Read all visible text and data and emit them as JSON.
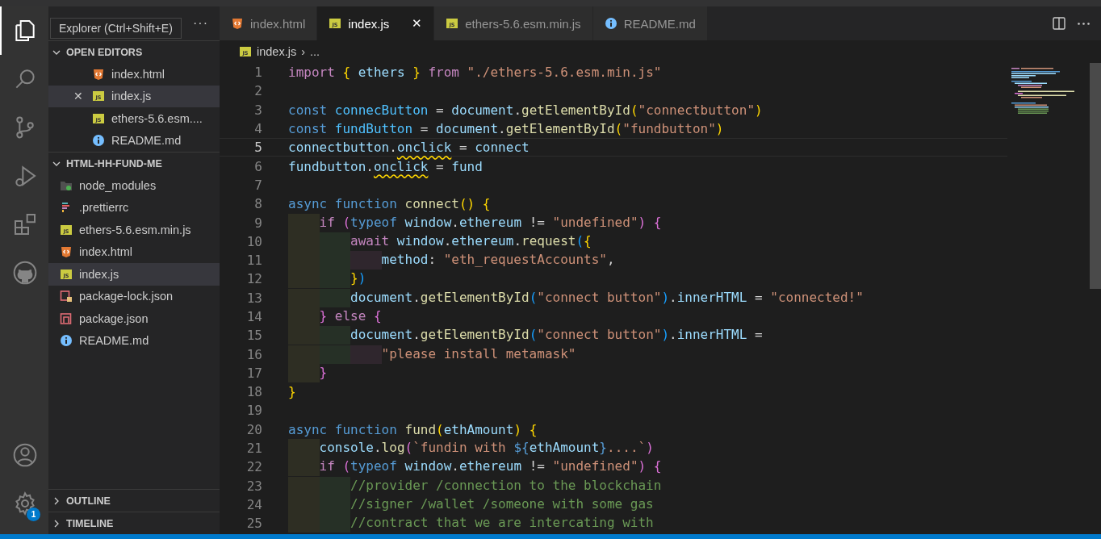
{
  "activity_bar": {
    "items": [
      {
        "kind": "files",
        "selected": true
      },
      {
        "kind": "search",
        "selected": false
      },
      {
        "kind": "source-control",
        "selected": false
      },
      {
        "kind": "run-debug",
        "selected": false
      },
      {
        "kind": "extensions",
        "selected": false
      },
      {
        "kind": "github",
        "selected": false
      }
    ],
    "bottom_items": [
      {
        "kind": "account"
      },
      {
        "kind": "settings",
        "badge": "1"
      }
    ]
  },
  "tooltip": {
    "text": "Explorer (Ctrl+Shift+E)"
  },
  "sidebar": {
    "actions": "···",
    "sections": [
      {
        "title": "OPEN EDITORS",
        "expanded": true,
        "items": [
          {
            "label": "index.html",
            "kind": "html",
            "selected": false
          },
          {
            "label": "index.js",
            "kind": "js",
            "icon_label": "JS",
            "selected": true,
            "close": "✕"
          },
          {
            "label": "ethers-5.6.esm....",
            "kind": "js",
            "icon_label": "JS",
            "selected": false
          },
          {
            "label": "README.md",
            "kind": "info",
            "selected": false
          }
        ]
      },
      {
        "title": "HTML-HH-FUND-ME",
        "expanded": true,
        "items": [
          {
            "label": "node_modules",
            "kind": "folder-node",
            "selected": false
          },
          {
            "label": ".prettierrc",
            "kind": "prettier",
            "selected": false
          },
          {
            "label": "ethers-5.6.esm.min.js",
            "kind": "js",
            "icon_label": "JS",
            "selected": false
          },
          {
            "label": "index.html",
            "kind": "html",
            "selected": false
          },
          {
            "label": "index.js",
            "kind": "js",
            "icon_label": "JS",
            "selected": true
          },
          {
            "label": "package-lock.json",
            "kind": "lock-json",
            "selected": false
          },
          {
            "label": "package.json",
            "kind": "json",
            "selected": false
          },
          {
            "label": "README.md",
            "kind": "info",
            "selected": false
          }
        ]
      }
    ],
    "bottom_sections": [
      {
        "title": "OUTLINE",
        "expanded": false
      },
      {
        "title": "TIMELINE",
        "expanded": false
      }
    ]
  },
  "tabs": [
    {
      "label": "index.html",
      "kind": "html",
      "selected": false
    },
    {
      "label": "index.js",
      "kind": "js",
      "icon_label": "JS",
      "selected": true,
      "close": "✕"
    },
    {
      "label": "ethers-5.6.esm.min.js",
      "kind": "js",
      "icon_label": "JS",
      "selected": false
    },
    {
      "label": "README.md",
      "kind": "info",
      "selected": false
    }
  ],
  "breadcrumb": {
    "file": "index.js",
    "kind": "js",
    "icon_label": "JS",
    "separator": "›",
    "rest": "..."
  },
  "editor": {
    "lines": [
      {
        "number": "1",
        "current": false,
        "tokens": [
          {
            "kind": "keyword",
            "text": "import "
          },
          {
            "kind": "brace1",
            "text": "{"
          },
          {
            "kind": "variable",
            "text": " ethers "
          },
          {
            "kind": "brace1",
            "text": "}"
          },
          {
            "kind": "keyword",
            "text": " from"
          },
          {
            "kind": "string",
            "text": " \"./ethers-5.6.esm.min.js\""
          }
        ]
      },
      {
        "number": "2",
        "current": false
      },
      {
        "number": "3",
        "current": false,
        "tokens": [
          {
            "kind": "storage",
            "text": "const"
          },
          {
            "kind": "constant",
            "text": " connecButton"
          },
          {
            "kind": "punct",
            "text": " = "
          },
          {
            "kind": "variable",
            "text": "document"
          },
          {
            "kind": "punct",
            "text": "."
          },
          {
            "kind": "function",
            "text": "getElementById"
          },
          {
            "kind": "brace1",
            "text": "("
          },
          {
            "kind": "string",
            "text": "\"connectbutton\""
          },
          {
            "kind": "brace1",
            "text": ")"
          }
        ]
      },
      {
        "number": "4",
        "current": false,
        "tokens": [
          {
            "kind": "storage",
            "text": "const"
          },
          {
            "kind": "constant",
            "text": " fundButton"
          },
          {
            "kind": "punct",
            "text": " = "
          },
          {
            "kind": "variable",
            "text": "document"
          },
          {
            "kind": "punct",
            "text": "."
          },
          {
            "kind": "function",
            "text": "getElementById"
          },
          {
            "kind": "brace1",
            "text": "("
          },
          {
            "kind": "string",
            "text": "\"fundbutton\""
          },
          {
            "kind": "brace1",
            "text": ")"
          }
        ]
      },
      {
        "number": "5",
        "current": true,
        "tokens": [
          {
            "kind": "variable",
            "text": "connectbutton"
          },
          {
            "kind": "punct",
            "text": "."
          },
          {
            "kind": "variable",
            "text": "onclick",
            "warning": true
          },
          {
            "kind": "punct",
            "text": " = "
          },
          {
            "kind": "variable",
            "text": "connect"
          }
        ]
      },
      {
        "number": "6",
        "current": false,
        "tokens": [
          {
            "kind": "variable",
            "text": "fundbutton"
          },
          {
            "kind": "punct",
            "text": "."
          },
          {
            "kind": "variable",
            "text": "onclick",
            "warning": true
          },
          {
            "kind": "punct",
            "text": " = "
          },
          {
            "kind": "variable",
            "text": "fund"
          }
        ]
      },
      {
        "number": "7",
        "current": false
      },
      {
        "number": "8",
        "current": false,
        "tokens": [
          {
            "kind": "storage",
            "text": "async"
          },
          {
            "kind": "storage",
            "text": " function"
          },
          {
            "kind": "function",
            "text": " connect"
          },
          {
            "kind": "brace1",
            "text": "()"
          },
          {
            "kind": "brace1",
            "text": " {"
          }
        ]
      },
      {
        "number": "9",
        "current": false,
        "tokens": [
          {
            "kind": "keyword",
            "text": "    if "
          },
          {
            "kind": "brace2",
            "text": "("
          },
          {
            "kind": "storage",
            "text": "typeof"
          },
          {
            "kind": "variable",
            "text": " window"
          },
          {
            "kind": "punct",
            "text": "."
          },
          {
            "kind": "variable",
            "text": "ethereum"
          },
          {
            "kind": "punct",
            "text": " != "
          },
          {
            "kind": "string",
            "text": "\"undefined\""
          },
          {
            "kind": "brace2",
            "text": ")"
          },
          {
            "kind": "brace2",
            "text": " {"
          }
        ]
      },
      {
        "number": "10",
        "current": false,
        "tokens": [
          {
            "kind": "keyword",
            "text": "        await"
          },
          {
            "kind": "variable",
            "text": " window"
          },
          {
            "kind": "punct",
            "text": "."
          },
          {
            "kind": "variable",
            "text": "ethereum"
          },
          {
            "kind": "punct",
            "text": "."
          },
          {
            "kind": "function",
            "text": "request"
          },
          {
            "kind": "brace3",
            "text": "("
          },
          {
            "kind": "brace1",
            "text": "{"
          }
        ]
      },
      {
        "number": "11",
        "current": false,
        "tokens": [
          {
            "kind": "variable",
            "text": "            method"
          },
          {
            "kind": "punct",
            "text": ": "
          },
          {
            "kind": "string",
            "text": "\"eth_requestAccounts\""
          },
          {
            "kind": "punct",
            "text": ","
          }
        ]
      },
      {
        "number": "12",
        "current": false,
        "tokens": [
          {
            "kind": "brace1",
            "text": "        }"
          },
          {
            "kind": "brace3",
            "text": ")"
          }
        ]
      },
      {
        "number": "13",
        "current": false,
        "tokens": [
          {
            "kind": "variable",
            "text": "        document"
          },
          {
            "kind": "punct",
            "text": "."
          },
          {
            "kind": "function",
            "text": "getElementById"
          },
          {
            "kind": "brace3",
            "text": "("
          },
          {
            "kind": "string",
            "text": "\"connect button\""
          },
          {
            "kind": "brace3",
            "text": ")"
          },
          {
            "kind": "punct",
            "text": "."
          },
          {
            "kind": "variable",
            "text": "innerHTML"
          },
          {
            "kind": "punct",
            "text": " = "
          },
          {
            "kind": "string",
            "text": "\"connected!\""
          }
        ]
      },
      {
        "number": "14",
        "current": false,
        "tokens": [
          {
            "kind": "brace2",
            "text": "    }"
          },
          {
            "kind": "keyword",
            "text": " else "
          },
          {
            "kind": "brace2",
            "text": "{"
          }
        ]
      },
      {
        "number": "15",
        "current": false,
        "tokens": [
          {
            "kind": "variable",
            "text": "        document"
          },
          {
            "kind": "punct",
            "text": "."
          },
          {
            "kind": "function",
            "text": "getElementById"
          },
          {
            "kind": "brace3",
            "text": "("
          },
          {
            "kind": "string",
            "text": "\"connect button\""
          },
          {
            "kind": "brace3",
            "text": ")"
          },
          {
            "kind": "punct",
            "text": "."
          },
          {
            "kind": "variable",
            "text": "innerHTML"
          },
          {
            "kind": "punct",
            "text": " ="
          }
        ]
      },
      {
        "number": "16",
        "current": false,
        "tokens": [
          {
            "kind": "string",
            "text": "            \"please install metamask\""
          }
        ]
      },
      {
        "number": "17",
        "current": false,
        "tokens": [
          {
            "kind": "brace2",
            "text": "    }"
          }
        ]
      },
      {
        "number": "18",
        "current": false,
        "tokens": [
          {
            "kind": "brace1",
            "text": "}"
          }
        ]
      },
      {
        "number": "19",
        "current": false
      },
      {
        "number": "20",
        "current": false,
        "tokens": [
          {
            "kind": "storage",
            "text": "async"
          },
          {
            "kind": "storage",
            "text": " function"
          },
          {
            "kind": "function",
            "text": " fund"
          },
          {
            "kind": "brace1",
            "text": "("
          },
          {
            "kind": "variable",
            "text": "ethAmount"
          },
          {
            "kind": "brace1",
            "text": ")"
          },
          {
            "kind": "brace1",
            "text": " {"
          }
        ]
      },
      {
        "number": "21",
        "current": false,
        "tokens": [
          {
            "kind": "variable",
            "text": "    console"
          },
          {
            "kind": "punct",
            "text": "."
          },
          {
            "kind": "function",
            "text": "log"
          },
          {
            "kind": "brace2",
            "text": "("
          },
          {
            "kind": "string",
            "text": "`fundin with "
          },
          {
            "kind": "storage",
            "text": "${"
          },
          {
            "kind": "variable",
            "text": "ethAmount"
          },
          {
            "kind": "storage",
            "text": "}"
          },
          {
            "kind": "string",
            "text": "....`"
          },
          {
            "kind": "brace2",
            "text": ")"
          }
        ]
      },
      {
        "number": "22",
        "current": false,
        "tokens": [
          {
            "kind": "keyword",
            "text": "    if "
          },
          {
            "kind": "brace2",
            "text": "("
          },
          {
            "kind": "storage",
            "text": "typeof"
          },
          {
            "kind": "variable",
            "text": " window"
          },
          {
            "kind": "punct",
            "text": "."
          },
          {
            "kind": "variable",
            "text": "ethereum"
          },
          {
            "kind": "punct",
            "text": " != "
          },
          {
            "kind": "string",
            "text": "\"undefined\""
          },
          {
            "kind": "brace2",
            "text": ")"
          },
          {
            "kind": "brace2",
            "text": " {"
          }
        ]
      },
      {
        "number": "23",
        "current": false,
        "tokens": [
          {
            "kind": "comment",
            "text": "        //provider /connection to the blockchain"
          }
        ]
      },
      {
        "number": "24",
        "current": false,
        "tokens": [
          {
            "kind": "comment",
            "text": "        //signer /wallet /someone with some gas"
          }
        ]
      },
      {
        "number": "25",
        "current": false,
        "tokens": [
          {
            "kind": "comment",
            "text": "        //contract that we are intercating with"
          }
        ]
      }
    ]
  }
}
